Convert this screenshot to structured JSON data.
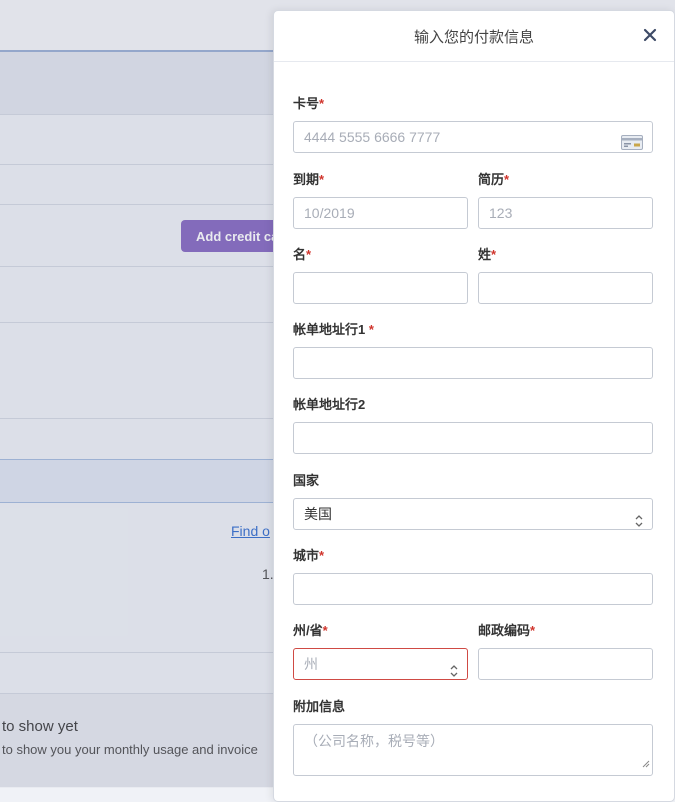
{
  "background": {
    "add_credit_card_button": "Add credit ca",
    "find_link": "Find o",
    "number_text": "1.",
    "empty_state": {
      "title": "to show yet",
      "subtitle": "to show you your monthly usage and invoice"
    }
  },
  "modal": {
    "title": "输入您的付款信息",
    "close_icon": "close-icon",
    "required_marker": "*",
    "fields": {
      "card_number": {
        "label": "卡号",
        "placeholder": "4444 5555 6666 7777",
        "icon": "credit-card-icon"
      },
      "expiry": {
        "label": "到期",
        "placeholder": "10/2019"
      },
      "cvc": {
        "label": "简历",
        "placeholder": "123"
      },
      "first_name": {
        "label": "名",
        "value": ""
      },
      "last_name": {
        "label": "姓",
        "value": ""
      },
      "address1": {
        "label": "帐单地址行1",
        "value": ""
      },
      "address2": {
        "label": "帐单地址行2",
        "value": ""
      },
      "country": {
        "label": "国家",
        "value": "美国",
        "icon": "select-chevron-icon"
      },
      "city": {
        "label": "城市",
        "value": ""
      },
      "state": {
        "label": "州/省",
        "placeholder": "州",
        "icon": "select-chevron-icon",
        "border_color": "#cf4a44"
      },
      "postal": {
        "label": "邮政编码",
        "value": ""
      },
      "extra": {
        "label": "附加信息",
        "placeholder": "（公司名称，税号等）"
      }
    }
  },
  "colors": {
    "accent_button": "#8b6fc4",
    "link": "#3b73d1",
    "required": "#d0342c",
    "error_border": "#cf4a44"
  }
}
